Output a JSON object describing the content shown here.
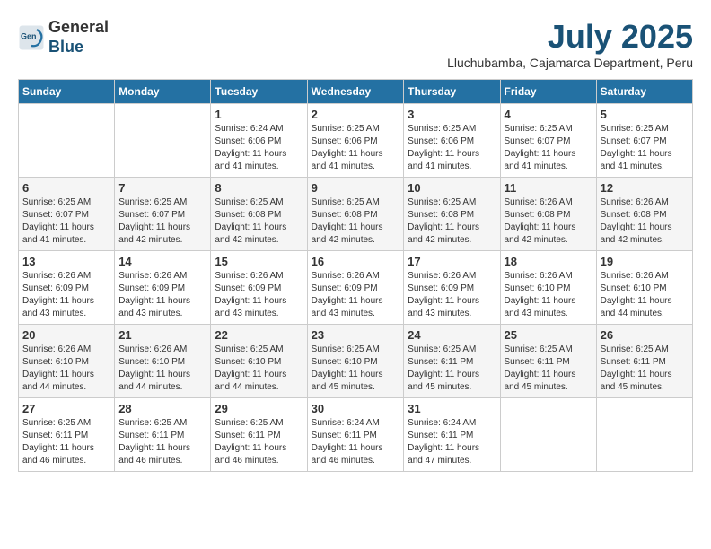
{
  "header": {
    "logo_line1": "General",
    "logo_line2": "Blue",
    "month": "July 2025",
    "location": "Lluchubamba, Cajamarca Department, Peru"
  },
  "weekdays": [
    "Sunday",
    "Monday",
    "Tuesday",
    "Wednesday",
    "Thursday",
    "Friday",
    "Saturday"
  ],
  "weeks": [
    [
      {
        "day": "",
        "info": ""
      },
      {
        "day": "",
        "info": ""
      },
      {
        "day": "1",
        "info": "Sunrise: 6:24 AM\nSunset: 6:06 PM\nDaylight: 11 hours and 41 minutes."
      },
      {
        "day": "2",
        "info": "Sunrise: 6:25 AM\nSunset: 6:06 PM\nDaylight: 11 hours and 41 minutes."
      },
      {
        "day": "3",
        "info": "Sunrise: 6:25 AM\nSunset: 6:06 PM\nDaylight: 11 hours and 41 minutes."
      },
      {
        "day": "4",
        "info": "Sunrise: 6:25 AM\nSunset: 6:07 PM\nDaylight: 11 hours and 41 minutes."
      },
      {
        "day": "5",
        "info": "Sunrise: 6:25 AM\nSunset: 6:07 PM\nDaylight: 11 hours and 41 minutes."
      }
    ],
    [
      {
        "day": "6",
        "info": "Sunrise: 6:25 AM\nSunset: 6:07 PM\nDaylight: 11 hours and 41 minutes."
      },
      {
        "day": "7",
        "info": "Sunrise: 6:25 AM\nSunset: 6:07 PM\nDaylight: 11 hours and 42 minutes."
      },
      {
        "day": "8",
        "info": "Sunrise: 6:25 AM\nSunset: 6:08 PM\nDaylight: 11 hours and 42 minutes."
      },
      {
        "day": "9",
        "info": "Sunrise: 6:25 AM\nSunset: 6:08 PM\nDaylight: 11 hours and 42 minutes."
      },
      {
        "day": "10",
        "info": "Sunrise: 6:25 AM\nSunset: 6:08 PM\nDaylight: 11 hours and 42 minutes."
      },
      {
        "day": "11",
        "info": "Sunrise: 6:26 AM\nSunset: 6:08 PM\nDaylight: 11 hours and 42 minutes."
      },
      {
        "day": "12",
        "info": "Sunrise: 6:26 AM\nSunset: 6:08 PM\nDaylight: 11 hours and 42 minutes."
      }
    ],
    [
      {
        "day": "13",
        "info": "Sunrise: 6:26 AM\nSunset: 6:09 PM\nDaylight: 11 hours and 43 minutes."
      },
      {
        "day": "14",
        "info": "Sunrise: 6:26 AM\nSunset: 6:09 PM\nDaylight: 11 hours and 43 minutes."
      },
      {
        "day": "15",
        "info": "Sunrise: 6:26 AM\nSunset: 6:09 PM\nDaylight: 11 hours and 43 minutes."
      },
      {
        "day": "16",
        "info": "Sunrise: 6:26 AM\nSunset: 6:09 PM\nDaylight: 11 hours and 43 minutes."
      },
      {
        "day": "17",
        "info": "Sunrise: 6:26 AM\nSunset: 6:09 PM\nDaylight: 11 hours and 43 minutes."
      },
      {
        "day": "18",
        "info": "Sunrise: 6:26 AM\nSunset: 6:10 PM\nDaylight: 11 hours and 43 minutes."
      },
      {
        "day": "19",
        "info": "Sunrise: 6:26 AM\nSunset: 6:10 PM\nDaylight: 11 hours and 44 minutes."
      }
    ],
    [
      {
        "day": "20",
        "info": "Sunrise: 6:26 AM\nSunset: 6:10 PM\nDaylight: 11 hours and 44 minutes."
      },
      {
        "day": "21",
        "info": "Sunrise: 6:26 AM\nSunset: 6:10 PM\nDaylight: 11 hours and 44 minutes."
      },
      {
        "day": "22",
        "info": "Sunrise: 6:25 AM\nSunset: 6:10 PM\nDaylight: 11 hours and 44 minutes."
      },
      {
        "day": "23",
        "info": "Sunrise: 6:25 AM\nSunset: 6:10 PM\nDaylight: 11 hours and 45 minutes."
      },
      {
        "day": "24",
        "info": "Sunrise: 6:25 AM\nSunset: 6:11 PM\nDaylight: 11 hours and 45 minutes."
      },
      {
        "day": "25",
        "info": "Sunrise: 6:25 AM\nSunset: 6:11 PM\nDaylight: 11 hours and 45 minutes."
      },
      {
        "day": "26",
        "info": "Sunrise: 6:25 AM\nSunset: 6:11 PM\nDaylight: 11 hours and 45 minutes."
      }
    ],
    [
      {
        "day": "27",
        "info": "Sunrise: 6:25 AM\nSunset: 6:11 PM\nDaylight: 11 hours and 46 minutes."
      },
      {
        "day": "28",
        "info": "Sunrise: 6:25 AM\nSunset: 6:11 PM\nDaylight: 11 hours and 46 minutes."
      },
      {
        "day": "29",
        "info": "Sunrise: 6:25 AM\nSunset: 6:11 PM\nDaylight: 11 hours and 46 minutes."
      },
      {
        "day": "30",
        "info": "Sunrise: 6:24 AM\nSunset: 6:11 PM\nDaylight: 11 hours and 46 minutes."
      },
      {
        "day": "31",
        "info": "Sunrise: 6:24 AM\nSunset: 6:11 PM\nDaylight: 11 hours and 47 minutes."
      },
      {
        "day": "",
        "info": ""
      },
      {
        "day": "",
        "info": ""
      }
    ]
  ]
}
